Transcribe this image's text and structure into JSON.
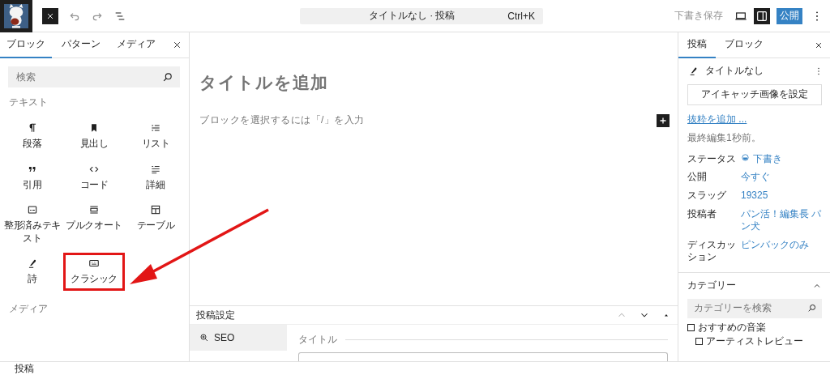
{
  "top_bar": {
    "document_bar": {
      "title": "タイトルなし · 投稿",
      "shortcut": "Ctrl+K"
    },
    "save_draft": "下書き保存",
    "settings_toggle": {
      "on": true
    },
    "publish": "公開"
  },
  "inserter": {
    "tabs": [
      {
        "label": "ブロック",
        "selected": true
      },
      {
        "label": "パターン",
        "selected": false
      },
      {
        "label": "メディア",
        "selected": false
      }
    ],
    "search": {
      "placeholder": "検索"
    },
    "text_heading": "テキスト",
    "blocks": [
      {
        "label": "段落",
        "kind": "paragraph",
        "highlighted": false
      },
      {
        "label": "見出し",
        "kind": "heading",
        "highlighted": false
      },
      {
        "label": "リスト",
        "kind": "list",
        "highlighted": false
      },
      {
        "label": "引用",
        "kind": "quote",
        "highlighted": false
      },
      {
        "label": "コード",
        "kind": "code",
        "highlighted": false
      },
      {
        "label": "詳細",
        "kind": "details",
        "highlighted": false
      },
      {
        "label": "整形済みテキスト",
        "kind": "preformatted",
        "highlighted": false
      },
      {
        "label": "プルクオート",
        "kind": "pullquote",
        "highlighted": false
      },
      {
        "label": "テーブル",
        "kind": "table",
        "highlighted": false
      },
      {
        "label": "詩",
        "kind": "verse",
        "highlighted": false
      },
      {
        "label": "クラシック",
        "kind": "classic",
        "highlighted": true
      }
    ],
    "media_heading": "メディア"
  },
  "editor": {
    "title_placeholder": "タイトルを追加",
    "block_placeholder": "ブロックを選択するには「/」を入力"
  },
  "meta_panel": {
    "title": "投稿設定",
    "tabs": [
      {
        "label": "SEO",
        "selected": true
      }
    ],
    "field_label": "タイトル"
  },
  "sidebar": {
    "tabs": [
      {
        "label": "投稿",
        "selected": true
      },
      {
        "label": "ブロック",
        "selected": false
      }
    ],
    "post_title": "タイトルなし",
    "featured_image_button": "アイキャッチ画像を設定",
    "excerpt_link": "抜粋を追加 ...",
    "last_edited": "最終編集1秒前。",
    "properties": [
      {
        "label": "ステータス",
        "value": "下書き",
        "kind": "status"
      },
      {
        "label": "公開",
        "value": "今すぐ",
        "kind": "link"
      },
      {
        "label": "スラッグ",
        "value": "19325",
        "kind": "link"
      },
      {
        "label": "投稿者",
        "value": "パン活！編集長 パン犬",
        "kind": "link"
      },
      {
        "label": "ディスカッション",
        "value": "ピンバックのみ",
        "kind": "link"
      }
    ],
    "categories": {
      "title": "カテゴリー",
      "expanded": true,
      "search": {
        "placeholder": "カテゴリーを検索"
      },
      "items": [
        {
          "label": "おすすめの音楽",
          "checked": false,
          "children": [
            {
              "label": "アーティストレビュー",
              "checked": false
            }
          ]
        }
      ]
    }
  },
  "status_bar": {
    "breadcrumb": "投稿"
  }
}
